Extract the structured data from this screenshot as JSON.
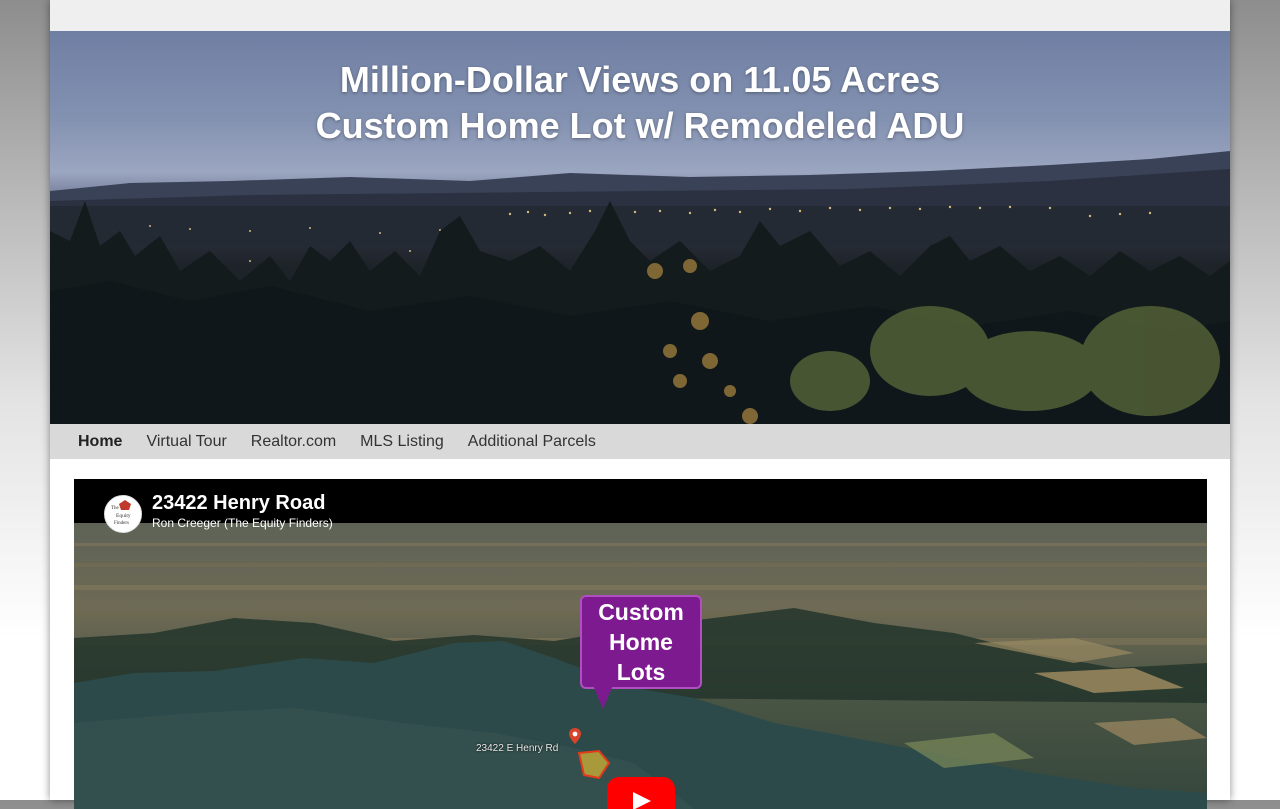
{
  "hero": {
    "title_line1": "Million-Dollar Views on 11.05 Acres",
    "title_line2": "Custom Home Lot w/ Remodeled ADU"
  },
  "nav": {
    "items": [
      {
        "label": "Home",
        "active": true
      },
      {
        "label": "Virtual Tour",
        "active": false
      },
      {
        "label": "Realtor.com",
        "active": false
      },
      {
        "label": "MLS Listing",
        "active": false
      },
      {
        "label": "Additional Parcels",
        "active": false
      }
    ]
  },
  "video": {
    "title": "23422 Henry Road",
    "channel": "Ron Creeger (The Equity Finders)",
    "callout": [
      "Custom",
      "Home",
      "Lots"
    ],
    "map_label": "23422 E Henry Rd",
    "logo_text": [
      "The",
      "Equity",
      "Finders"
    ],
    "icons": {
      "play": "play-icon",
      "pin": "map-pin-icon"
    }
  },
  "colors": {
    "callout": "#7e1a8f",
    "play_button": "#ff0000",
    "nav_bg": "#d9d9d9",
    "top_strip": "#efefef"
  }
}
